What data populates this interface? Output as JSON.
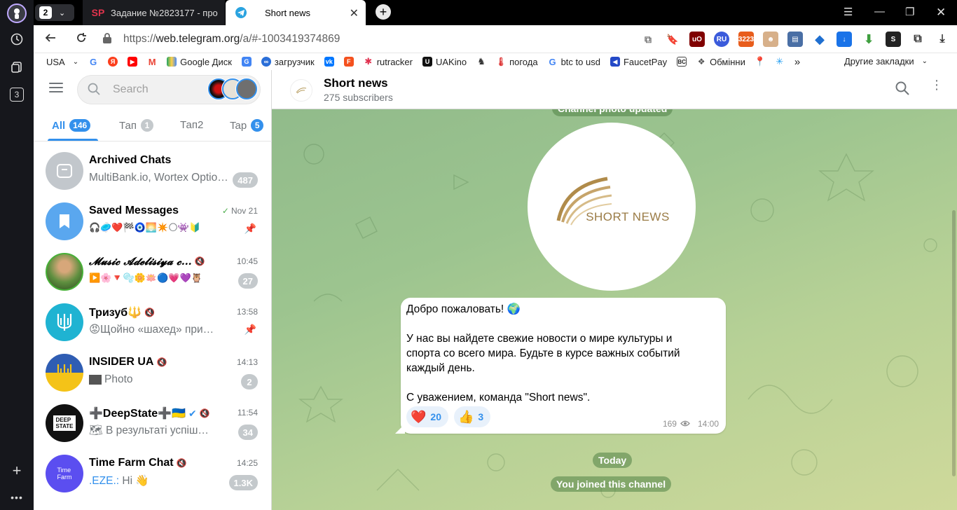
{
  "browser": {
    "tab_count": "2",
    "tabs": [
      {
        "favicon": "SP",
        "title": "Задание №2823177 - про"
      },
      {
        "favicon": "telegram",
        "title": "Short news"
      }
    ],
    "url_prefix": "https://",
    "url_host": "web.telegram.org",
    "url_rest": "/a/#-1003419374869",
    "sidebar_badge": "3",
    "bookmarks": [
      {
        "label": "USA",
        "icon": "dropdown"
      },
      {
        "label": "",
        "icon": "google",
        "color": "#4285f4"
      },
      {
        "label": "",
        "icon": "yandex",
        "color": "#fc3f1d"
      },
      {
        "label": "",
        "icon": "youtube",
        "color": "#ff0000"
      },
      {
        "label": "",
        "icon": "gmail",
        "color": "#ea4335"
      },
      {
        "label": "Google Диск",
        "icon": "drive",
        "color": "#1fa463"
      },
      {
        "label": "",
        "icon": "translate",
        "color": "#4285f4"
      },
      {
        "label": "загрузчик",
        "icon": "link",
        "color": "#2a6ed8"
      },
      {
        "label": "",
        "icon": "vk",
        "color": "#0077ff"
      },
      {
        "label": "",
        "icon": "f-app",
        "color": "#f4511e"
      },
      {
        "label": "rutracker",
        "icon": "rutracker",
        "color": "#e0304e"
      },
      {
        "label": "UAKino",
        "icon": "uakino",
        "color": "#111111"
      },
      {
        "label": "",
        "icon": "chess",
        "color": "#333333"
      },
      {
        "label": "погода",
        "icon": "thermometer",
        "color": "#d33"
      },
      {
        "label": "btc to usd",
        "icon": "google",
        "color": "#4285f4"
      },
      {
        "label": "FaucetPay",
        "icon": "faucetpay",
        "color": "#2449c7"
      },
      {
        "label": "",
        "icon": "bc",
        "color": "#444444"
      },
      {
        "label": "Обмінни",
        "icon": "exchange",
        "color": "#555"
      },
      {
        "label": "",
        "icon": "maps",
        "color": "#34a853"
      },
      {
        "label": "",
        "icon": "star",
        "color": "#1d9bf0"
      },
      {
        "label": "»",
        "icon": "more"
      }
    ],
    "other_bookmarks": "Другие закладки"
  },
  "telegram": {
    "search_placeholder": "Search",
    "folders": [
      {
        "label": "All",
        "badge": "146",
        "active": true
      },
      {
        "label": "Тап",
        "badge": "1",
        "active": false
      },
      {
        "label": "Тап2",
        "badge": "",
        "active": false
      },
      {
        "label": "Tap",
        "badge": "5",
        "active": false,
        "blue": true
      }
    ],
    "chats": [
      {
        "title": "Archived Chats",
        "time": "",
        "sender": "",
        "message": "MultiBank.io, Wortex Optio…",
        "badge": "487",
        "pinned": false,
        "muted": false,
        "avatar_color": "#c2c7cc",
        "avatar_icon": "archive-icon"
      },
      {
        "title": "Saved Messages",
        "time": "Nov 21",
        "sender": "",
        "message": "🎧🥏❤️🏁🧿🌅✴️🌕👾🔰",
        "badge": "",
        "pinned": true,
        "muted": false,
        "read": true,
        "avatar_color": "#5aa7ef",
        "avatar_icon": "bookmark-icon"
      },
      {
        "title": "𝓜𝓾𝓼𝓲𝓬 𝓐𝓭𝓮𝓵𝓲𝓼𝓲𝔂𝓪 𝓬…",
        "time": "10:45",
        "sender": "",
        "message": "▶️🌸🔻🫧🌼🪷🔵💗💜🦉",
        "badge": "27",
        "pinned": false,
        "muted": true,
        "avatar_color": "#5e8f3f",
        "avatar_icon": "photo-avatar"
      },
      {
        "title": "Тризуб🔱",
        "time": "13:58",
        "sender": "",
        "message": "😡Щойно «шахед» при…",
        "badge": "",
        "pinned": true,
        "muted": true,
        "avatar_color": "#1fb3d2",
        "avatar_icon": "trident-icon"
      },
      {
        "title": "INSIDER UA",
        "time": "14:13",
        "sender": "",
        "message": "Photo",
        "badge": "2",
        "pinned": false,
        "muted": true,
        "avatar_color": "#2f5db3",
        "avatar_icon": "trident-icon"
      },
      {
        "title": "➕DeepState➕🇺🇦",
        "time": "11:54",
        "sender": "",
        "message": "🗺 В результаті успіш…",
        "badge": "34",
        "pinned": false,
        "muted": true,
        "verified": true,
        "avatar_color": "#111111",
        "avatar_icon": "deepstate-logo"
      },
      {
        "title": "Time Farm Chat",
        "time": "14:25",
        "sender": ".EZE.:",
        "message": " Hi 👋",
        "badge": "1.3K",
        "pinned": false,
        "muted": true,
        "avatar_color": "#5b4ef0",
        "avatar_icon": "timefarm-logo"
      }
    ],
    "channel": {
      "title": "Short news",
      "subtitle": "275 subscribers",
      "service_photo": "Channel photo updated",
      "logo_text": "SHORT NEWS",
      "message_lines": [
        "Добро пожаловать! 🌍",
        "",
        "У нас вы найдете свежие новости о мире культуры и",
        "спорта со всего мира. Будьте в курсе важных событий",
        "каждый день.",
        "",
        "С уважением, команда \"Short news\"."
      ],
      "reactions": [
        {
          "emoji": "❤️",
          "count": "20"
        },
        {
          "emoji": "👍",
          "count": "3"
        }
      ],
      "views": "169",
      "time": "14:00",
      "date_pill": "Today",
      "joined": "You joined this channel"
    }
  }
}
